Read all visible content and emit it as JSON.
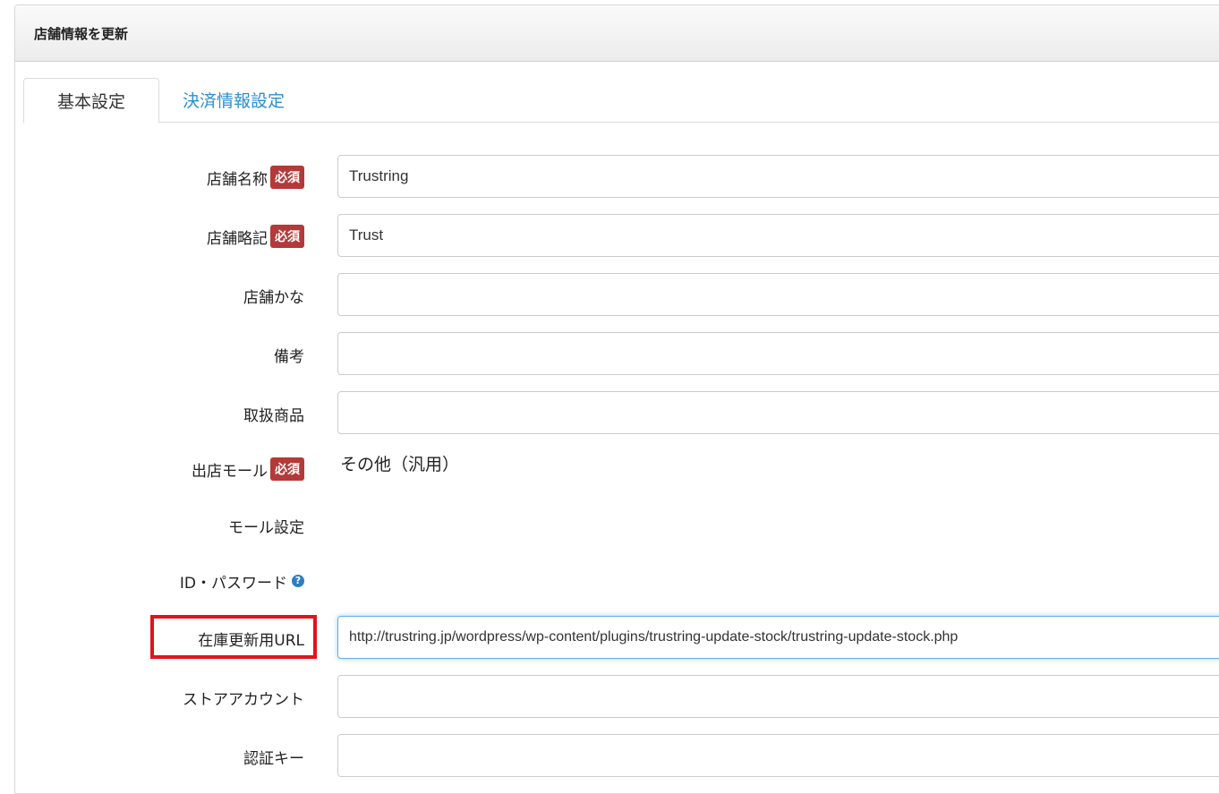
{
  "panel": {
    "title": "店舗情報を更新"
  },
  "tabs": [
    {
      "label": "基本設定",
      "active": true
    },
    {
      "label": "決済情報設定",
      "active": false
    }
  ],
  "required_label": "必須",
  "fields": {
    "store_name": {
      "label": "店舗名称",
      "required": true,
      "value": "Trustring"
    },
    "store_short": {
      "label": "店舗略記",
      "required": true,
      "value": "Trust"
    },
    "store_kana": {
      "label": "店舗かな",
      "value": ""
    },
    "remarks": {
      "label": "備考",
      "value": ""
    },
    "products": {
      "label": "取扱商品",
      "value": ""
    },
    "mall": {
      "label": "出店モール",
      "required": true,
      "value": "その他（汎用）"
    },
    "mall_settings": {
      "label": "モール設定"
    },
    "id_password": {
      "label": "ID・パスワード",
      "help_icon": "question-circle-icon"
    },
    "stock_url": {
      "label": "在庫更新用URL",
      "value": "http://trustring.jp/wordpress/wp-content/plugins/trustring-update-stock/trustring-update-stock.php"
    },
    "store_account": {
      "label": "ストアアカウント",
      "value": ""
    },
    "auth_key": {
      "label": "認証キー",
      "value": ""
    }
  },
  "colors": {
    "required_badge": "#b33a38",
    "tab_link": "#2a8fd0",
    "highlight_box": "#e0141b",
    "help_icon": "#2a7fc5"
  }
}
